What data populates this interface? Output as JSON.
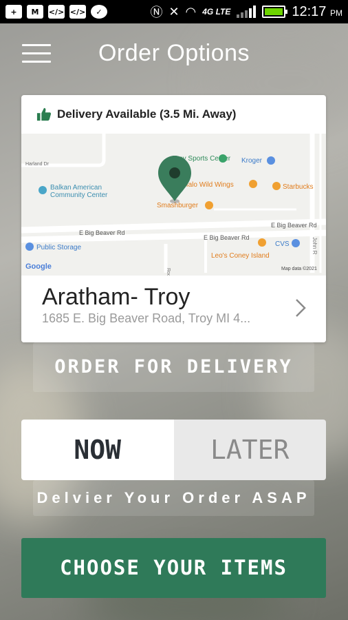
{
  "status_bar": {
    "left_icons": [
      "plus-box-icon",
      "gmail-icon",
      "code-icon",
      "code-icon",
      "chat-bubble-icon"
    ],
    "right_icons": [
      "nfc-icon",
      "mute-icon",
      "wifi-icon",
      "signal-icon",
      "battery-icon"
    ],
    "network": "4G LTE",
    "time": "12:17",
    "ampm": "PM"
  },
  "header": {
    "title": "Order Options",
    "menu_icon": "hamburger-menu-icon"
  },
  "store_card": {
    "delivery_status": "Delivery Available (3.5 Mi. Away)",
    "delivery_icon": "thumbs-up-icon",
    "store_name": "Aratham- Troy",
    "store_address": "1685 E. Big Beaver Road, Troy MI 4...",
    "map": {
      "labels": {
        "harland": "Harland Dr",
        "balkan_1": "Balkan American",
        "balkan_2": "Community Center",
        "troy_sports": "Troy Sports Center",
        "kroger": "Kroger",
        "buffalo": "Buffalo Wild Wings",
        "starbucks": "Starbucks",
        "smashburger": "Smashburger",
        "big_beaver_1": "E Big Beaver Rd",
        "big_beaver_2": "E Big Beaver Rd",
        "big_beaver_3": "E Big Beaver Rd",
        "public_storage": "Public Storage",
        "cvs": "CVS",
        "leos": "Leo's Coney Island",
        "rochester": "Rochester Ct",
        "john_r": "John R",
        "google": "Google",
        "map_data": "Map data ©2021"
      }
    }
  },
  "buttons": {
    "order_for_delivery": "ORDER FOR DELIVERY",
    "now": "NOW",
    "later": "LATER",
    "asap_note": "Delvier Your Order ASAP",
    "choose_items": "CHOOSE YOUR ITEMS"
  },
  "colors": {
    "brand_green": "#2f7a59",
    "pin_green": "#3a7d5c",
    "status_green": "#2a7d4f"
  }
}
